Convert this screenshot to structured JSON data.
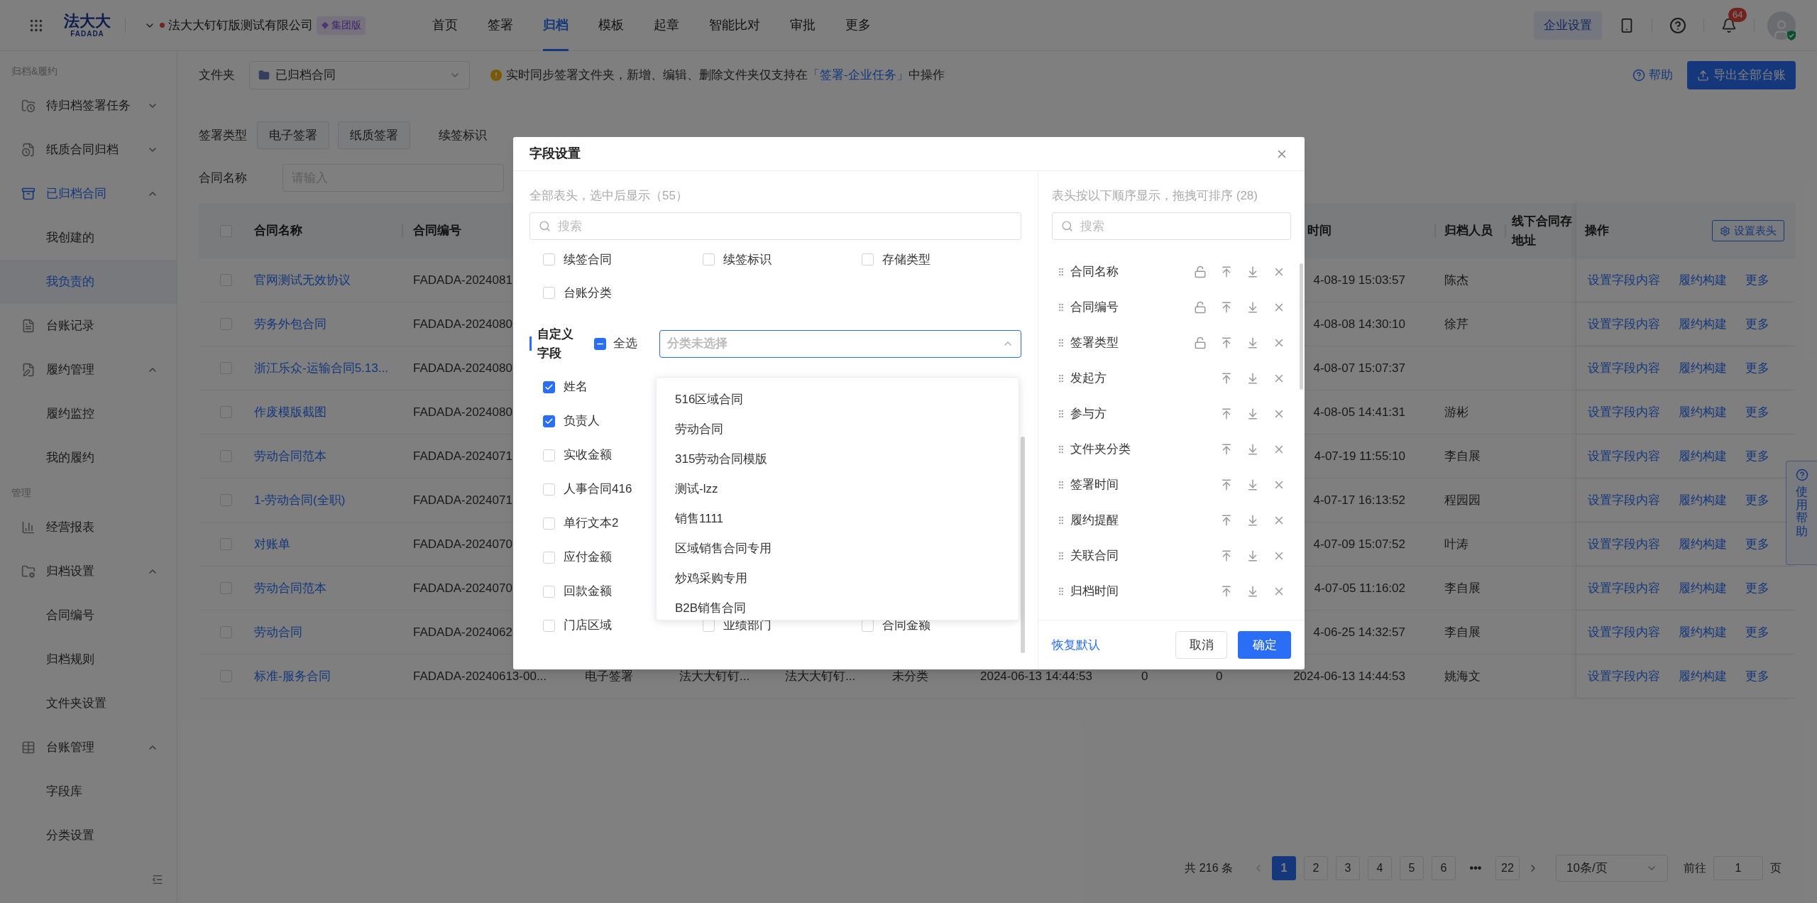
{
  "header": {
    "logo_top": "法大大",
    "logo_bottom": "FADADA",
    "company": "法大大钉钉版测试有限公司",
    "badge": "集团版",
    "nav": [
      {
        "label": "首页",
        "selected": false
      },
      {
        "label": "签署",
        "selected": false
      },
      {
        "label": "归档",
        "selected": true
      },
      {
        "label": "模板",
        "selected": false
      },
      {
        "label": "起章",
        "selected": false
      },
      {
        "label": "智能比对",
        "selected": false
      },
      {
        "label": "审批",
        "selected": false
      },
      {
        "label": "更多",
        "selected": false
      }
    ],
    "settings_button": "企业设置",
    "notification_count": "64"
  },
  "sidebar": {
    "sections": [
      {
        "title": "归档&履约",
        "items": [
          {
            "label": "待归档签署任务",
            "expanded": false,
            "active": false
          },
          {
            "label": "纸质合同归档",
            "expanded": false,
            "active": false
          },
          {
            "label": "已归档合同",
            "expanded": true,
            "active": true,
            "children": [
              {
                "label": "我创建的",
                "selected": false
              },
              {
                "label": "我负责的",
                "selected": true
              }
            ]
          },
          {
            "label": "台账记录",
            "active": false
          },
          {
            "label": "履约管理",
            "expanded": true,
            "active": false,
            "children": [
              {
                "label": "履约监控",
                "selected": false
              },
              {
                "label": "我的履约",
                "selected": false
              }
            ]
          }
        ]
      },
      {
        "title": "管理",
        "items": [
          {
            "label": "经营报表",
            "active": false
          },
          {
            "label": "归档设置",
            "expanded": true,
            "active": false,
            "children": [
              {
                "label": "合同编号",
                "selected": false
              },
              {
                "label": "归档规则",
                "selected": false
              },
              {
                "label": "文件夹设置",
                "selected": false
              }
            ]
          },
          {
            "label": "台账管理",
            "expanded": true,
            "active": false,
            "children": [
              {
                "label": "字段库",
                "selected": false
              },
              {
                "label": "分类设置",
                "selected": false
              }
            ]
          }
        ]
      }
    ]
  },
  "toolbar": {
    "folder_label": "文件夹",
    "folder_value": "已归档合同",
    "notice": "实时同步签署文件夹，新增、编辑、删除文件夹仅支持在",
    "notice_link": "「签署-企业任务」",
    "notice_tail": "中操作",
    "help": "帮助",
    "export_button": "导出全部台账"
  },
  "filters": {
    "sign_type_label": "签署类型",
    "sign_type_options": [
      "电子签署",
      "纸质签署"
    ],
    "renewal_label": "续签标识",
    "name_label": "合同名称",
    "name_placeholder": "请输入"
  },
  "table": {
    "header": {
      "checked": false,
      "name": "合同名称",
      "number": "合同编号",
      "archive_time": "时间",
      "archiver": "归档人员",
      "offline": "线下合同存地址",
      "actions": "操作",
      "settings_button": "设置表头"
    },
    "rows": [
      {
        "checked": false,
        "name": "官网测试无效协议",
        "number": "FADADA-2024081",
        "archive_time": "4-08-19 15:03:57",
        "archiver": "陈杰",
        "actions": [
          "设置字段内容",
          "履约构建",
          "更多"
        ]
      },
      {
        "checked": false,
        "name": "劳务外包合同",
        "number": "FADADA-2024080",
        "archive_time": "4-08-08 14:30:10",
        "archiver": "徐芹",
        "actions": [
          "设置字段内容",
          "履约构建",
          "更多"
        ]
      },
      {
        "checked": false,
        "name": "浙江乐众-运输合同5.13...",
        "number": "FADADA-2024080",
        "archive_time": "4-08-07 15:07:37",
        "actions": [
          "设置字段内容",
          "履约构建",
          "更多"
        ]
      },
      {
        "checked": false,
        "name": "作废模版截图",
        "number": "FADADA-2024080",
        "archive_time": "4-08-05 14:41:31",
        "archiver": "游彬",
        "actions": [
          "设置字段内容",
          "履约构建",
          "更多"
        ]
      },
      {
        "checked": false,
        "name": "劳动合同范本",
        "number": "FADADA-2024071",
        "archive_time": "4-07-19 11:55:10",
        "archiver": "李自展",
        "actions": [
          "设置字段内容",
          "履约构建",
          "更多"
        ]
      },
      {
        "checked": false,
        "name": "1-劳动合同(全职)",
        "number": "FADADA-2024071",
        "archive_time": "4-07-17 16:13:52",
        "archiver": "程园园",
        "actions": [
          "设置字段内容",
          "履约构建",
          "更多"
        ]
      },
      {
        "checked": false,
        "name": "对账单",
        "number": "FADADA-2024070",
        "archive_time": "4-07-09 15:07:52",
        "archiver": "叶涛",
        "actions": [
          "设置字段内容",
          "履约构建",
          "更多"
        ]
      },
      {
        "checked": false,
        "name": "劳动合同范本",
        "number": "FADADA-2024070",
        "archive_time": "4-07-05 11:16:02",
        "archiver": "李自展",
        "actions": [
          "设置字段内容",
          "履约构建",
          "更多"
        ]
      },
      {
        "checked": false,
        "name": "劳动合同",
        "number": "FADADA-2024062",
        "archive_time": "4-06-25 14:32:57",
        "archiver": "李自展",
        "actions": [
          "设置字段内容",
          "履约构建",
          "更多"
        ]
      },
      {
        "checked": false,
        "name": "标准-服务合同",
        "number": "FADADA-20240613-00...",
        "sign_type": "电子签署",
        "initiator": "法大大钉钉...",
        "participant": "法大大钉钉...",
        "folder": "未分类",
        "sign_time": "2024-06-13 14:44:53",
        "column_9": "0",
        "column_10": "0",
        "archive_time": "2024-06-13 14:44:53",
        "archiver": "姚海文",
        "actions": [
          "设置字段内容",
          "履约构建",
          "更多"
        ]
      }
    ]
  },
  "pagination": {
    "total": "共 216 条",
    "pages": [
      {
        "kind": "page",
        "label": "1",
        "selected": true
      },
      {
        "kind": "page",
        "label": "2",
        "selected": false
      },
      {
        "kind": "page",
        "label": "3",
        "selected": false
      },
      {
        "kind": "page",
        "label": "4",
        "selected": false
      },
      {
        "kind": "page",
        "label": "5",
        "selected": false
      },
      {
        "kind": "page",
        "label": "6",
        "selected": false
      },
      {
        "kind": "ellipsis",
        "label": "•••"
      },
      {
        "kind": "page",
        "label": "22",
        "selected": false
      }
    ],
    "page_size": "10条/页",
    "goto_label": "前往",
    "goto_value": "1",
    "goto_suffix": "页"
  },
  "help_tab": "使用帮助",
  "modal": {
    "title": "字段设置",
    "left": {
      "subtitle": "全部表头，选中后显示（55）",
      "search_placeholder": "搜索",
      "fields": [
        {
          "label": "续签合同",
          "checked": false
        },
        {
          "label": "续签标识",
          "checked": false
        },
        {
          "label": "存储类型",
          "checked": false
        },
        {
          "label": "台账分类",
          "checked": false
        }
      ],
      "custom": {
        "title": "自定义字段",
        "select_all": "全选",
        "select_all_indeterminate": true,
        "category_placeholder": "分类未选择",
        "expanded": true,
        "rows": [
          [
            {
              "label": "姓名",
              "checked": true
            }
          ],
          [
            {
              "label": "负责人",
              "checked": true
            }
          ],
          [
            {
              "label": "实收金额",
              "checked": false
            }
          ],
          [
            {
              "label": "人事合同416",
              "checked": false
            }
          ],
          [
            {
              "label": "单行文本2",
              "checked": false
            }
          ],
          [
            {
              "label": "应付金额",
              "checked": false
            }
          ],
          [
            {
              "label": "回款金额",
              "checked": false
            }
          ],
          [
            {
              "label": "门店区域",
              "checked": false
            },
            {
              "label": "业绩部门",
              "checked": false
            },
            {
              "label": "合同金额",
              "checked": false
            }
          ]
        ],
        "options": [
          "516区域合同",
          "劳动合同",
          "315劳动合同模版",
          "测试-lzz",
          "销售1111",
          "区域销售合同专用",
          "炒鸡采购专用",
          "B2B销售合同"
        ]
      }
    },
    "right": {
      "subtitle": "表头按以下顺序显示，拖拽可排序 (28)",
      "search_placeholder": "搜索",
      "items": [
        {
          "label": "合同名称",
          "lock": true
        },
        {
          "label": "合同编号",
          "lock": true
        },
        {
          "label": "签署类型",
          "lock": true
        },
        {
          "label": "发起方",
          "lock": false
        },
        {
          "label": "参与方",
          "lock": false
        },
        {
          "label": "文件夹分类",
          "lock": false
        },
        {
          "label": "签署时间",
          "lock": false
        },
        {
          "label": "履约提醒",
          "lock": false
        },
        {
          "label": "关联合同",
          "lock": false
        },
        {
          "label": "归档时间",
          "lock": false
        }
      ]
    },
    "footer": {
      "reset": "恢复默认",
      "cancel": "取消",
      "confirm": "确定"
    }
  }
}
